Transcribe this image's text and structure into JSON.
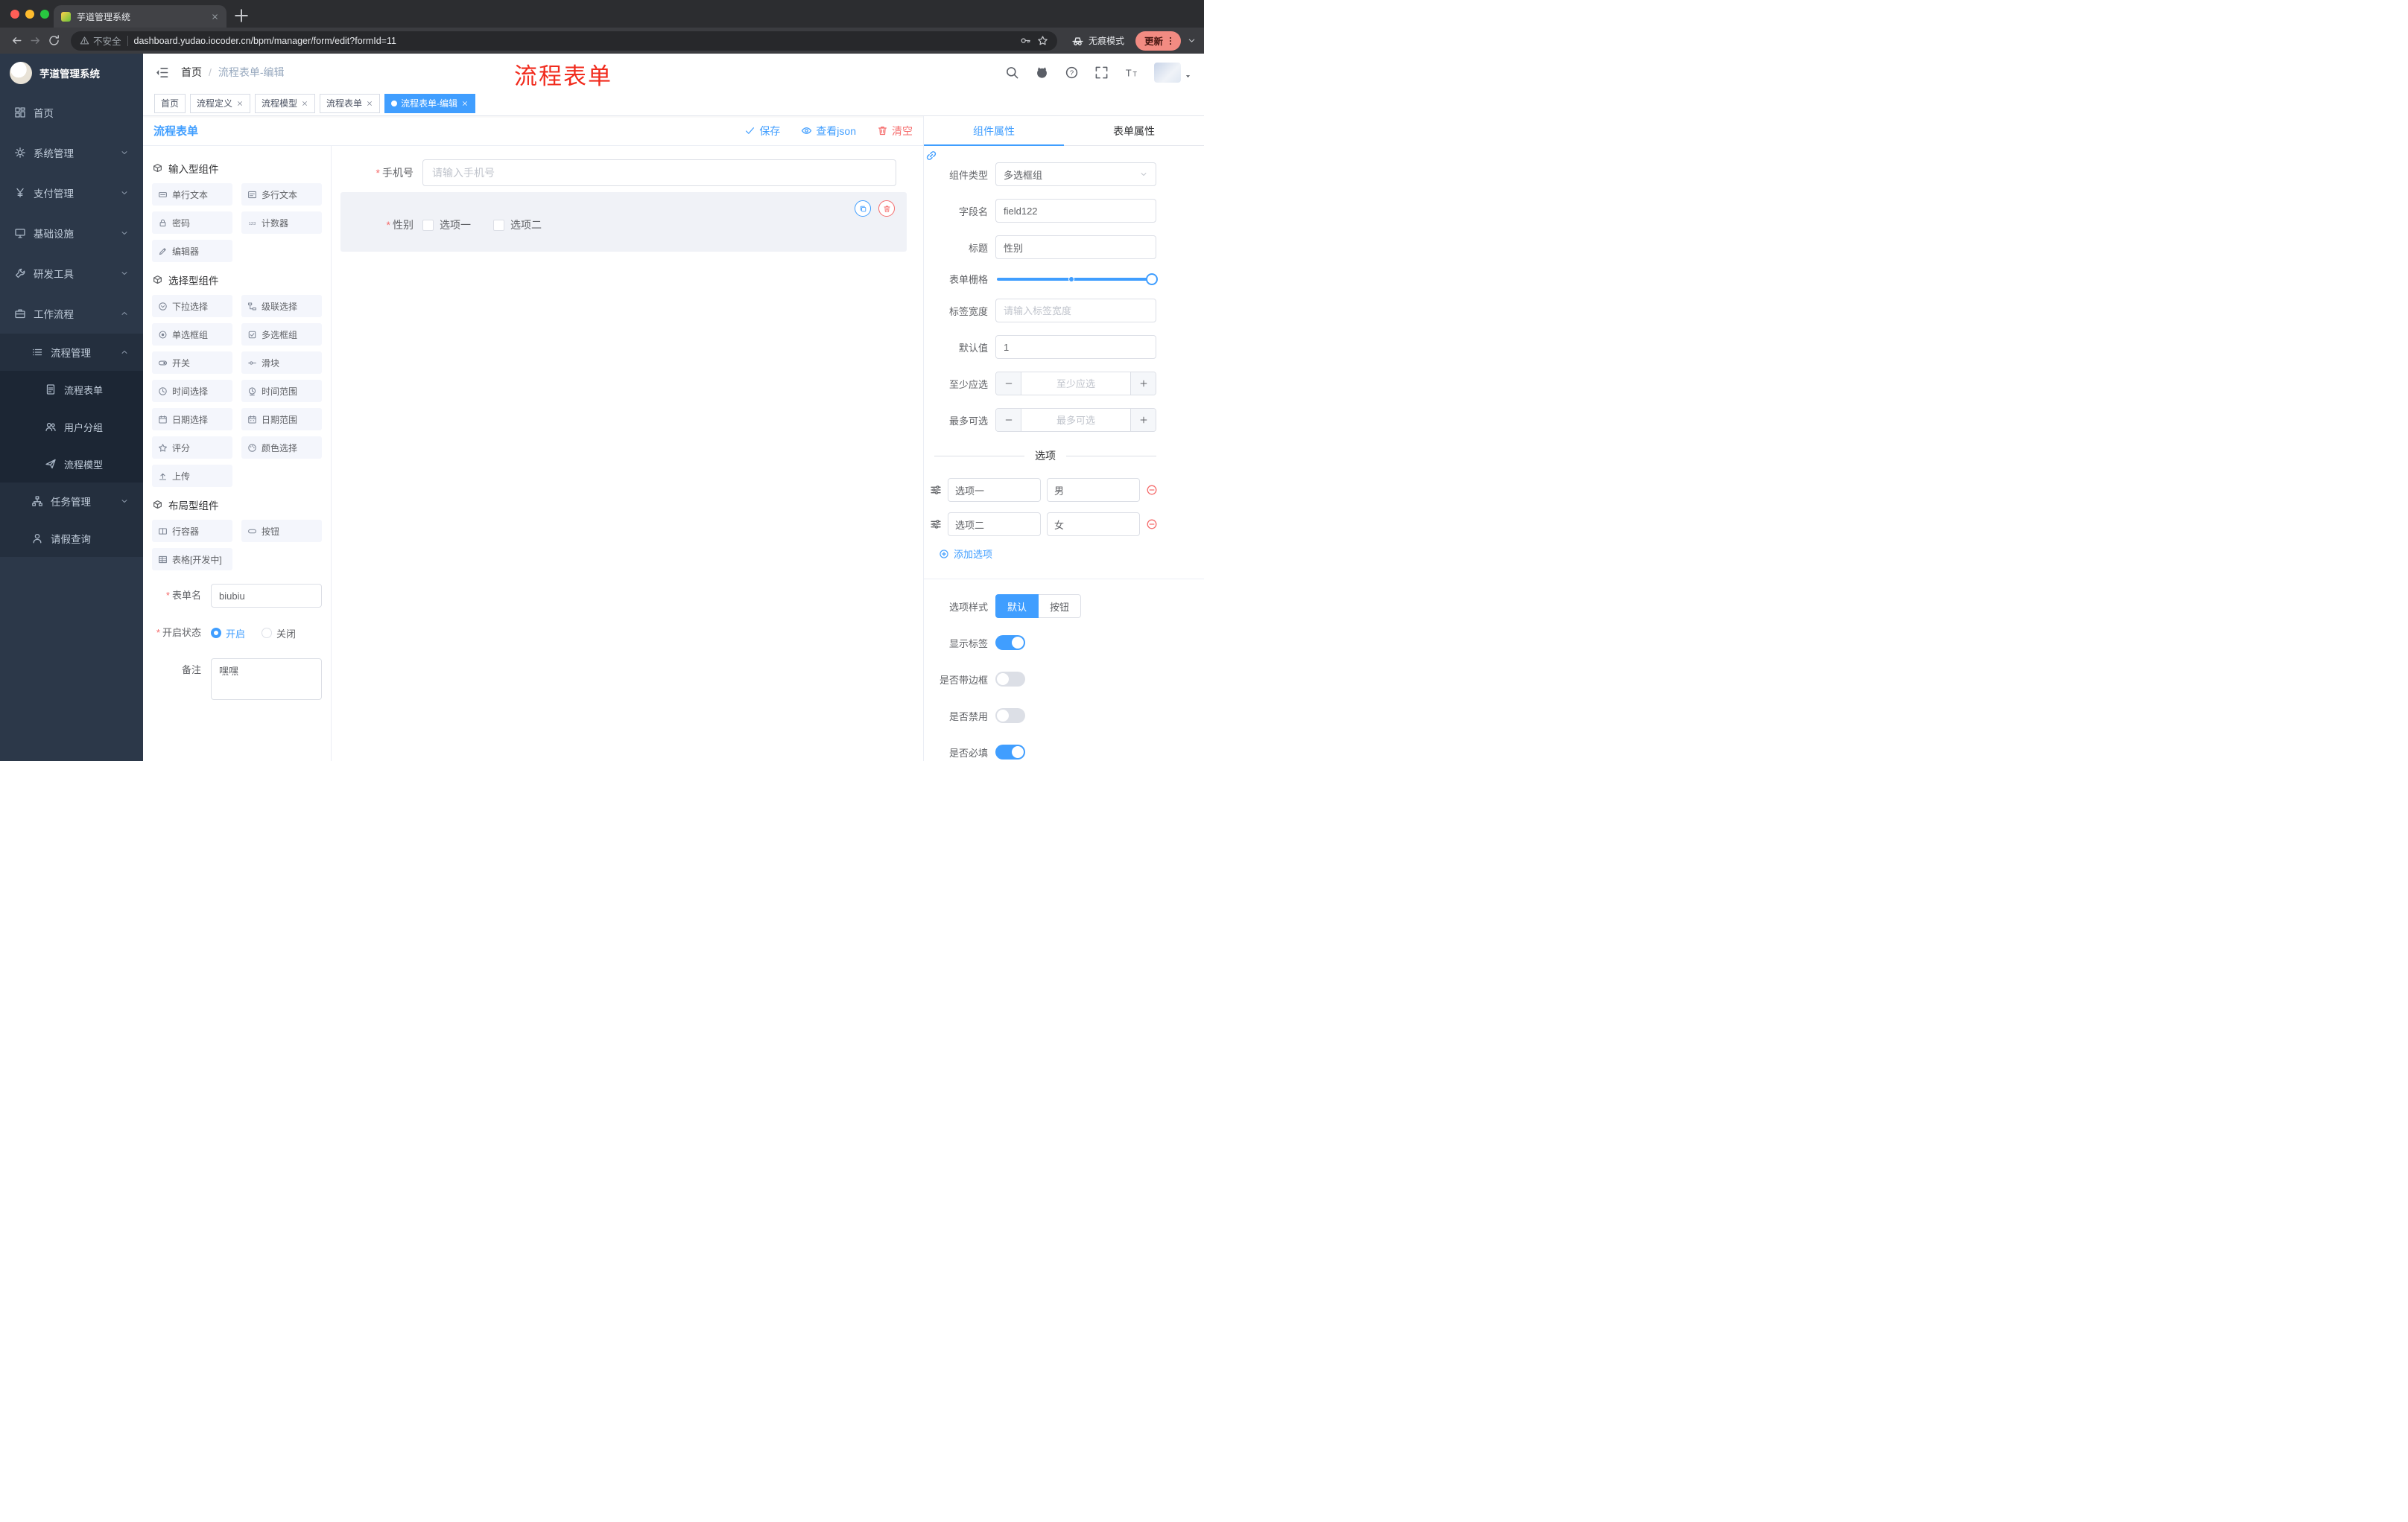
{
  "colors": {
    "accent": "#409EFF",
    "danger": "#F56C6C",
    "annotation": "#F12B1D"
  },
  "browser": {
    "tab_title": "芋道管理系统",
    "security_label": "不安全",
    "url": "dashboard.yudao.iocoder.cn/bpm/manager/form/edit?formId=11",
    "incognito_label": "无痕模式",
    "update_label": "更新"
  },
  "sidebar": {
    "brand": "芋道管理系统",
    "items": [
      {
        "icon": "home-icon",
        "label": "首页",
        "depth": 1,
        "chevron": ""
      },
      {
        "icon": "gear-icon",
        "label": "系统管理",
        "depth": 1,
        "chevron": "down"
      },
      {
        "icon": "yen-icon",
        "label": "支付管理",
        "depth": 1,
        "chevron": "down"
      },
      {
        "icon": "monitor-icon",
        "label": "基础设施",
        "depth": 1,
        "chevron": "down"
      },
      {
        "icon": "tool-icon",
        "label": "研发工具",
        "depth": 1,
        "chevron": "down"
      },
      {
        "icon": "briefcase-icon",
        "label": "工作流程",
        "depth": 1,
        "chevron": "up"
      },
      {
        "icon": "list-icon",
        "label": "流程管理",
        "depth": 2,
        "chevron": "up"
      },
      {
        "icon": "doc-icon",
        "label": "流程表单",
        "depth": 3,
        "chevron": ""
      },
      {
        "icon": "users-icon",
        "label": "用户分组",
        "depth": 3,
        "chevron": ""
      },
      {
        "icon": "send-icon",
        "label": "流程模型",
        "depth": 3,
        "chevron": ""
      },
      {
        "icon": "tree-icon",
        "label": "任务管理",
        "depth": 2,
        "chevron": "down"
      },
      {
        "icon": "person-icon",
        "label": "请假查询",
        "depth": 2,
        "chevron": ""
      }
    ]
  },
  "header": {
    "breadcrumb_home": "首页",
    "breadcrumb_sep": "/",
    "breadcrumb_current": "流程表单-编辑",
    "annotation": "流程表单"
  },
  "tags": [
    {
      "label": "首页",
      "active": false,
      "closable": false
    },
    {
      "label": "流程定义",
      "active": false,
      "closable": true
    },
    {
      "label": "流程模型",
      "active": false,
      "closable": true
    },
    {
      "label": "流程表单",
      "active": false,
      "closable": true
    },
    {
      "label": "流程表单-编辑",
      "active": true,
      "closable": true
    }
  ],
  "designer": {
    "title": "流程表单",
    "actions": {
      "save": "保存",
      "view_json": "查看json",
      "clear": "清空"
    },
    "palette": {
      "sections": [
        {
          "title": "输入型组件",
          "icon": "cube-icon",
          "items": [
            {
              "icon": "textline-icon",
              "label": "单行文本"
            },
            {
              "icon": "textarea-icon",
              "label": "多行文本"
            },
            {
              "icon": "lock-icon",
              "label": "密码"
            },
            {
              "icon": "counter-icon",
              "label": "计数器"
            },
            {
              "icon": "editor-icon",
              "label": "编辑器"
            }
          ]
        },
        {
          "title": "选择型组件",
          "icon": "cube-icon",
          "items": [
            {
              "icon": "select-icon",
              "label": "下拉选择"
            },
            {
              "icon": "cascade-icon",
              "label": "级联选择"
            },
            {
              "icon": "radio-icon",
              "label": "单选框组"
            },
            {
              "icon": "checkbox-icon",
              "label": "多选框组"
            },
            {
              "icon": "switch-icon",
              "label": "开关"
            },
            {
              "icon": "slider-icon",
              "label": "滑块"
            },
            {
              "icon": "clock-icon",
              "label": "时间选择"
            },
            {
              "icon": "clockrange-icon",
              "label": "时间范围"
            },
            {
              "icon": "calendar-icon",
              "label": "日期选择"
            },
            {
              "icon": "daterange-icon",
              "label": "日期范围"
            },
            {
              "icon": "star-icon",
              "label": "评分"
            },
            {
              "icon": "color-icon",
              "label": "颜色选择"
            },
            {
              "icon": "upload-icon",
              "label": "上传"
            }
          ]
        },
        {
          "title": "布局型组件",
          "icon": "cube-icon",
          "items": [
            {
              "icon": "row-icon",
              "label": "行容器"
            },
            {
              "icon": "button-icon",
              "label": "按钮"
            },
            {
              "icon": "table-icon",
              "label": "表格[开发中]"
            }
          ]
        }
      ]
    },
    "meta_form": {
      "name_label": "表单名",
      "name_value": "biubiu",
      "status_label": "开启状态",
      "status_on": "开启",
      "status_off": "关闭",
      "remark_label": "备注",
      "remark_value": "嘿嘿"
    },
    "canvas": {
      "phone": {
        "label": "手机号",
        "placeholder": "请输入手机号"
      },
      "gender": {
        "label": "性别",
        "option1": "选项一",
        "option2": "选项二"
      }
    }
  },
  "props": {
    "tab_component": "组件属性",
    "tab_form": "表单属性",
    "component_type_label": "组件类型",
    "component_type_value": "多选框组",
    "field_name_label": "字段名",
    "field_name_value": "field122",
    "title_label": "标题",
    "title_value": "性别",
    "grid_label": "表单栅格",
    "label_width_label": "标签宽度",
    "label_width_placeholder": "请输入标签宽度",
    "default_label": "默认值",
    "default_value": "1",
    "min_label": "至少应选",
    "min_placeholder": "至少应选",
    "max_label": "最多可选",
    "max_placeholder": "最多可选",
    "options_title": "选项",
    "options": [
      {
        "name": "选项一",
        "value": "男"
      },
      {
        "name": "选项二",
        "value": "女"
      }
    ],
    "add_option": "添加选项",
    "style_label": "选项样式",
    "style_default": "默认",
    "style_button": "按钮",
    "switch_rows": [
      {
        "label": "显示标签",
        "on": true
      },
      {
        "label": "是否带边框",
        "on": false
      },
      {
        "label": "是否禁用",
        "on": false
      },
      {
        "label": "是否必填",
        "on": true
      }
    ]
  }
}
